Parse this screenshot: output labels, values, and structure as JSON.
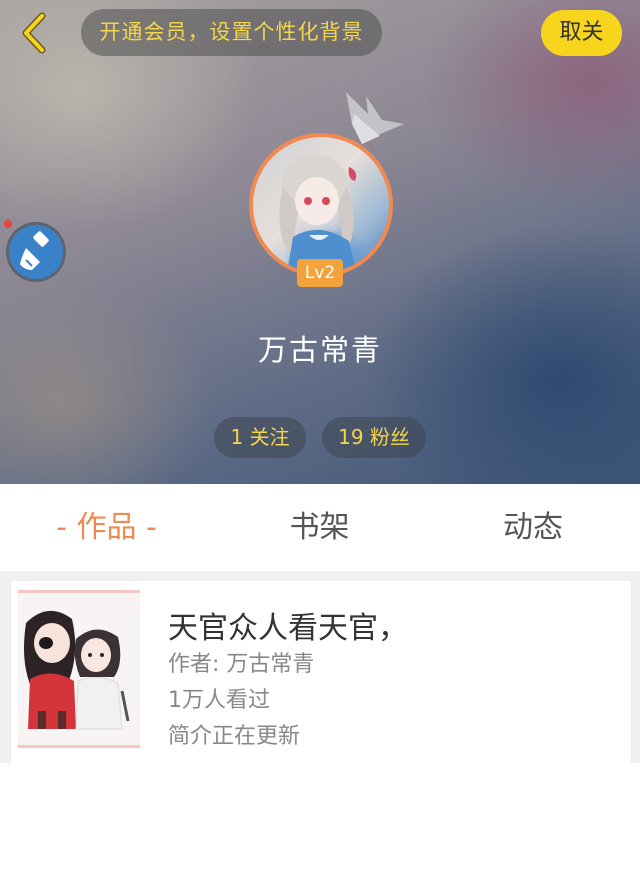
{
  "header": {
    "member_prompt": "开通会员，设置个性化背景",
    "unfollow_label": "取关",
    "level_badge": "Lv2",
    "username": "万古常青",
    "following_label": "1 关注",
    "followers_label": "19 粉丝"
  },
  "tabs": [
    {
      "label": "- 作品 -",
      "active": true
    },
    {
      "label": "书架",
      "active": false
    },
    {
      "label": "动态",
      "active": false
    }
  ],
  "works": [
    {
      "title": "天官众人看天官，",
      "author": "作者: 万古常青",
      "views": "1万人看过",
      "intro": "简介正在更新"
    }
  ],
  "colors": {
    "accent": "#f08a53",
    "unfollow_bg": "#f7d51d",
    "pill_text": "#f3d64a",
    "level_bg": "#f4a23b",
    "skin_button": "#3a82c8"
  },
  "icons": {
    "back": "chevron-left-icon",
    "crown": "crown-icon",
    "skin": "paint-brush-icon"
  }
}
